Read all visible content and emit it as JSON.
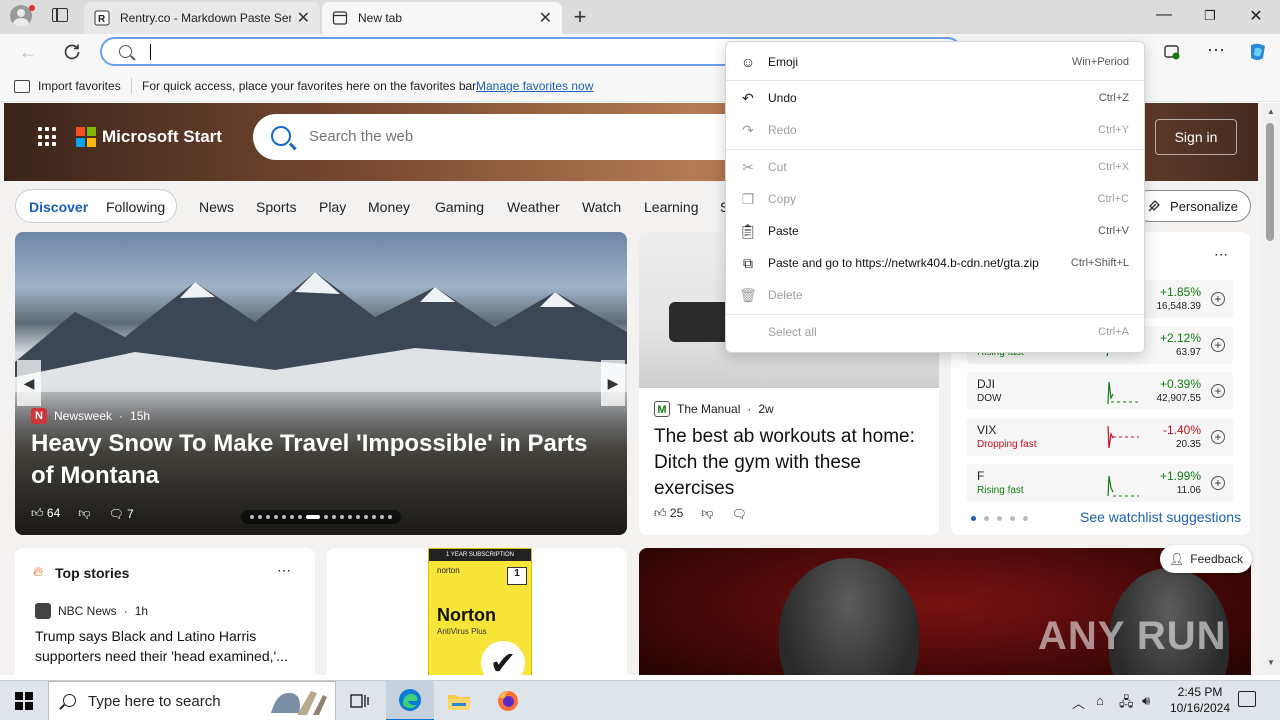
{
  "browser": {
    "tabs": [
      {
        "label": "Rentry.co - Markdown Paste Serv"
      },
      {
        "label": "New tab"
      }
    ],
    "address": {
      "value": ""
    },
    "favorites_bar": {
      "import_label": "Import favorites",
      "hint": "For quick access, place your favorites here on the favorites bar.",
      "manage_link": "Manage favorites now"
    }
  },
  "context_menu": {
    "items": [
      {
        "label": "Emoji",
        "shortcut": "Win+Period",
        "enabled": true
      },
      {
        "label": "Undo",
        "shortcut": "Ctrl+Z",
        "enabled": true
      },
      {
        "label": "Redo",
        "shortcut": "Ctrl+Y",
        "enabled": false
      },
      {
        "label": "Cut",
        "shortcut": "Ctrl+X",
        "enabled": false
      },
      {
        "label": "Copy",
        "shortcut": "Ctrl+C",
        "enabled": false
      },
      {
        "label": "Paste",
        "shortcut": "Ctrl+V",
        "enabled": true
      },
      {
        "label": "Paste and go to https://netwrk404.b-cdn.net/gta.zip",
        "shortcut": "Ctrl+Shift+L",
        "enabled": true
      },
      {
        "label": "Delete",
        "shortcut": "",
        "enabled": false
      },
      {
        "label": "Select all",
        "shortcut": "Ctrl+A",
        "enabled": false
      }
    ]
  },
  "start_page": {
    "brand": "Microsoft Start",
    "search_placeholder": "Search the web",
    "sign_in": "Sign in",
    "feed_tabs": {
      "discover": "Discover",
      "following": "Following"
    },
    "categories": [
      "News",
      "Sports",
      "Play",
      "Money",
      "Gaming",
      "Weather",
      "Watch",
      "Learning",
      "S"
    ],
    "personalize": "Personalize",
    "hero": {
      "source": "Newsweek",
      "source_initial": "N",
      "age": "15h",
      "title": "Heavy Snow To Make Travel 'Impossible' in Parts of Montana",
      "likes": "64",
      "comments": "7"
    },
    "article": {
      "source": "The Manual",
      "source_initial": "M",
      "age": "2w",
      "title": "The best ab workouts at home: Ditch the gym with these exercises",
      "likes": "25"
    },
    "stocks": [
      {
        "symbol": "",
        "subtitle": "",
        "change": "+1.85%",
        "price": "16,548.39",
        "direction": "up"
      },
      {
        "symbol": "",
        "subtitle": "Rising fast",
        "change": "+2.12%",
        "price": "63.97",
        "direction": "up"
      },
      {
        "symbol": "DJI",
        "subtitle": "DOW",
        "change": "+0.39%",
        "price": "42,907.55",
        "direction": "up"
      },
      {
        "symbol": "VIX",
        "subtitle": "Dropping fast",
        "change": "-1.40%",
        "price": "20.35",
        "direction": "down"
      },
      {
        "symbol": "F",
        "subtitle": "Rising fast",
        "change": "+1.99%",
        "price": "11.06",
        "direction": "up"
      }
    ],
    "watchlist_link": "See watchlist suggestions",
    "top_stories": {
      "heading": "Top stories",
      "source": "NBC News",
      "age": "1h",
      "title": "Trump says Black and Latino Harris supporters need their 'head examined,'..."
    },
    "ad": {
      "banner": "1 YEAR SUBSCRIPTION",
      "brand": "norton",
      "name": "Norton",
      "product": "AntiVirus Plus"
    },
    "feedback": "Feedback",
    "watermark": "ANY RUN"
  },
  "taskbar": {
    "search_placeholder": "Type here to search",
    "time": "2:45 PM",
    "date": "10/16/2024"
  },
  "icons": [
    "profile-icon",
    "tab-actions-icon",
    "back-icon",
    "refresh-icon",
    "search-icon",
    "extensions-icon",
    "more-icon",
    "copilot-icon",
    "windows-start-icon",
    "task-view-icon",
    "edge-icon",
    "file-explorer-icon",
    "firefox-icon"
  ],
  "colors": {
    "accent": "#1a5fb4",
    "up": "#107c10",
    "down": "#c50f1f",
    "omnibox_border": "#6aa0e8"
  }
}
